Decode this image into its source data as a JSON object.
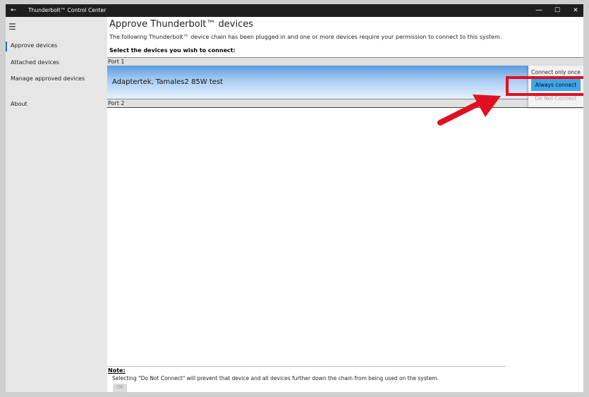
{
  "window": {
    "title": "Thunderbolt™ Control Center",
    "back_icon": "←",
    "minimize_icon": "—",
    "maximize_icon": "☐",
    "close_icon": "✕"
  },
  "sidebar": {
    "menu_icon": "☰",
    "items": [
      {
        "label": "Approve devices",
        "selected": true
      },
      {
        "label": "Attached devices"
      },
      {
        "label": "Manage approved devices"
      },
      {
        "label": "About"
      }
    ]
  },
  "main": {
    "title": "Approve Thunderbolt™ devices",
    "description": "The following Thunderbolt™ device chain has been plugged in and one or more devices require your permission to connect to this system.",
    "select_label": "Select the devices you wish to connect:",
    "ports": [
      {
        "label": "Port 1",
        "devices": [
          {
            "name": "Adaptertek, Tamales2 85W test"
          }
        ]
      },
      {
        "label": "Port 2",
        "devices": []
      }
    ],
    "dropdown": {
      "options": [
        "Connect only once",
        "Always connect",
        "Do Not Connect"
      ],
      "highlighted": "Always connect",
      "disabled": "Do Not Connect"
    }
  },
  "note": {
    "label": "Note:",
    "text": "Selecting \"Do Not Connect\" will prevent that device and all devices further down the chain from being used on the system.",
    "ok_label": "OK"
  },
  "colors": {
    "accent": "#3ea7e8",
    "annotation_red": "#e01020",
    "titlebar": "#1f1f1f"
  }
}
